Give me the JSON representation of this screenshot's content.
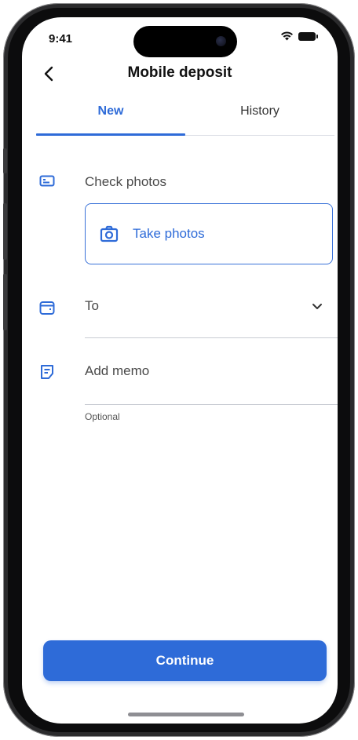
{
  "status_bar": {
    "time": "9:41"
  },
  "header": {
    "title": "Mobile deposit"
  },
  "tabs": [
    {
      "label": "New",
      "active": true
    },
    {
      "label": "History",
      "active": false
    }
  ],
  "form": {
    "check_photos": {
      "label": "Check photos",
      "button_label": "Take photos"
    },
    "to": {
      "label": "To"
    },
    "memo": {
      "label": "Add memo",
      "helper": "Optional"
    }
  },
  "footer": {
    "continue_label": "Continue"
  },
  "colors": {
    "accent": "#2e6bd8",
    "text": "#121212",
    "muted": "#4a4a4a",
    "divider": "#c9ccd3"
  }
}
